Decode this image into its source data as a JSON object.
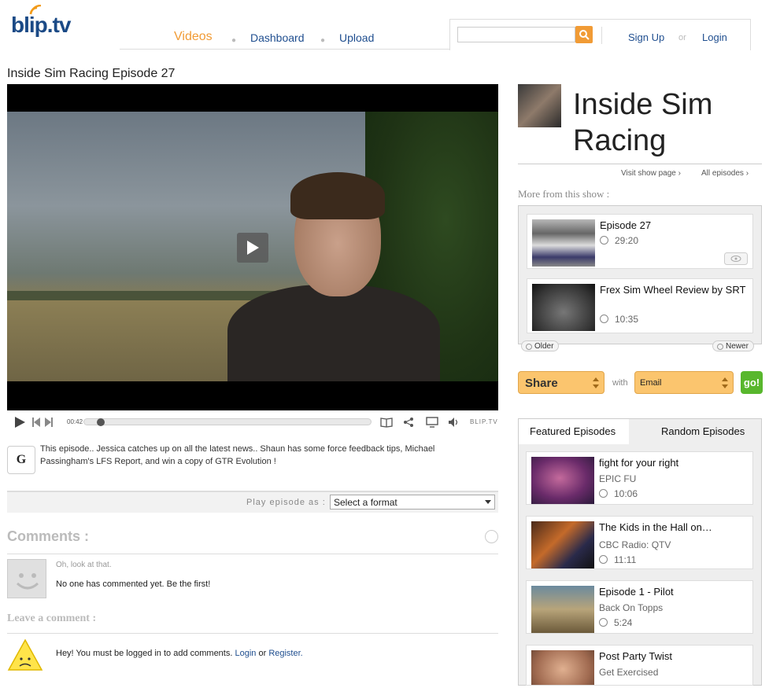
{
  "header": {
    "logo": "blip.tv",
    "nav": [
      {
        "label": "Videos"
      },
      {
        "label": "Dashboard"
      },
      {
        "label": "Upload"
      }
    ],
    "search_placeholder": "",
    "signup": "Sign Up",
    "or": "or",
    "login": "Login"
  },
  "episode": {
    "title": "Inside Sim Racing Episode 27",
    "time": "00:42",
    "brand": "BLIP.TV",
    "progress": 0.03,
    "description": "This episode.. Jessica catches up on all the latest news.. Shaun has some force feedback tips, Michael Passingham's LFS Report, and win a copy of GTR Evolution !",
    "format_label": "Play episode as :",
    "format_value": "Select a format"
  },
  "comments": {
    "heading": "Comments :",
    "small": "Oh, look at that.",
    "text": "No one has commented yet. Be the first!",
    "leave_heading": "Leave a comment :",
    "leave_prefix": "Hey! You must be logged in to add comments.",
    "leave_login": "Login",
    "leave_or": "or",
    "leave_register": "Register."
  },
  "show": {
    "title": "Inside Sim Racing",
    "visit": "Visit show page ›",
    "all": "All episodes ›",
    "more_heading": "More from this show :",
    "episodes": [
      {
        "title": "Episode 27",
        "duration": "29:20"
      },
      {
        "title": "Frex Sim Wheel Review by SRT",
        "duration": "10:35"
      }
    ],
    "older": "Older",
    "newer": "Newer"
  },
  "share": {
    "label": "Share",
    "with": "with",
    "method": "Email",
    "go": "go!"
  },
  "tabs": {
    "featured": "Featured Episodes",
    "random": "Random Episodes",
    "items": [
      {
        "title": "fight for your right",
        "show": "EPIC FU",
        "duration": "10:06"
      },
      {
        "title": "The Kids in the Hall on…",
        "show": "CBC Radio: QTV",
        "duration": "11:11"
      },
      {
        "title": "Episode 1 - Pilot",
        "show": "Back On Topps",
        "duration": "5:24"
      },
      {
        "title": "Post Party Twist",
        "show": "Get Exercised",
        "duration": ""
      }
    ]
  }
}
